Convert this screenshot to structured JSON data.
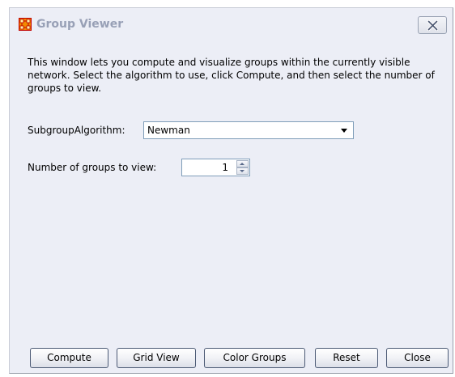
{
  "window": {
    "title": "Group Viewer",
    "title_icon": "group-viewer-app-icon",
    "close_icon": "close-x-icon"
  },
  "description": "This window lets you compute and visualize groups within the currently visible network. Select the algorithm to use, click Compute, and then select the number of groups to view.",
  "algorithm": {
    "label": "SubgroupAlgorithm:",
    "selected": "Newman",
    "arrow_icon": "chevron-down-icon"
  },
  "groups": {
    "label": "Number of groups to view:",
    "value": "1"
  },
  "buttons": {
    "compute": "Compute",
    "grid_view": "Grid View",
    "color_groups": "Color Groups",
    "reset": "Reset",
    "close": "Close"
  },
  "colors": {
    "window_bg": "#eceef6",
    "title_text": "#98a0b6",
    "icon_orange": "#f28a00",
    "icon_red": "#c00000"
  }
}
